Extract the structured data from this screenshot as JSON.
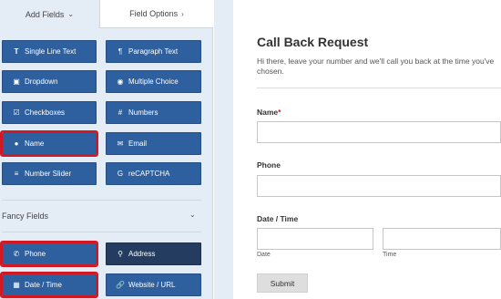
{
  "tabs": {
    "add_fields": "Add Fields",
    "field_options": "Field Options"
  },
  "fields": [
    {
      "label": "Single Line Text",
      "icon": "text-icon"
    },
    {
      "label": "Paragraph Text",
      "icon": "paragraph-icon"
    },
    {
      "label": "Dropdown",
      "icon": "dropdown-icon"
    },
    {
      "label": "Multiple Choice",
      "icon": "radio-icon"
    },
    {
      "label": "Checkboxes",
      "icon": "checkbox-icon"
    },
    {
      "label": "Numbers",
      "icon": "hash-icon"
    },
    {
      "label": "Name",
      "icon": "user-icon"
    },
    {
      "label": "Email",
      "icon": "envelope-icon"
    },
    {
      "label": "Number Slider",
      "icon": "slider-icon"
    },
    {
      "label": "reCAPTCHA",
      "icon": "google-icon"
    }
  ],
  "fancy": {
    "title": "Fancy Fields",
    "items": [
      {
        "label": "Phone",
        "icon": "phone-icon"
      },
      {
        "label": "Address",
        "icon": "map-marker-icon"
      },
      {
        "label": "Date / Time",
        "icon": "calendar-icon"
      },
      {
        "label": "Website / URL",
        "icon": "link-icon"
      }
    ]
  },
  "form": {
    "title": "Call Back Request",
    "description": "Hi there, leave your number and we'll call you back at the time you've chosen.",
    "name_label": "Name",
    "required_mark": "*",
    "phone_label": "Phone",
    "datetime_label": "Date / Time",
    "date_sub": "Date",
    "time_sub": "Time",
    "submit_label": "Submit"
  },
  "colors": {
    "field_button": "#2e5f9e",
    "highlight": "#d21923",
    "panel_bg": "#e4ecf5"
  }
}
